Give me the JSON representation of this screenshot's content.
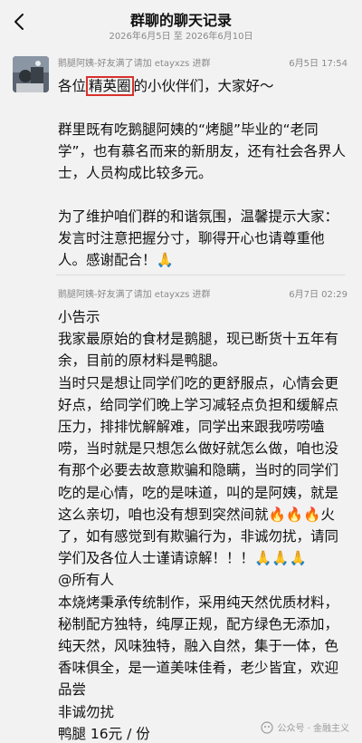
{
  "header": {
    "title": "群聊的聊天记录",
    "date_range": "2026年6月5日 至 2026年6月10日"
  },
  "messages": [
    {
      "sender": "鹅腿阿姨-好友满了请加 etayxzs 进群",
      "time": "6月5日 17:54",
      "greeting_before": "各位",
      "greeting_boxed": "精英圈",
      "greeting_after": "的小伙伴们，大家好～",
      "para2": "群里既有吃鹅腿阿姨的“烤腿”毕业的“老同学”，也有慕名而来的新朋友，还有社会各界人士，人员构成比较多元。",
      "para3": "为了维护咱们群的和谐氛围，温馨提示大家：发言时注意把握分寸，聊得开心也请尊重他人。感谢配合！🙏"
    },
    {
      "sender": "鹅腿阿姨-好友满了请加 etayxzs 进群",
      "time": "6月7日 02:29",
      "lines": [
        "小告示",
        "我家最原始的食材是鹅腿，现已断货十五年有余，目前的原材料是鸭腿。",
        "当时只是想让同学们吃的更舒服点，心情会更好点，给同学们晚上学习减轻点负担和缓解点压力，排排忧解解难，同学出来跟我唠唠嗑唠，当时就是只想怎么做好就怎么做，咱也没有那个必要去故意欺骗和隐瞒，当时的同学们吃的是心情，吃的是味道，叫的是阿姨，就是这么亲切，咱也没有想到突然间就🔥🔥🔥火了，如有感觉到有欺骗行为，非诚勿扰，请同学们及各位人士谨请谅解！！！🙏🙏🙏",
        "@所有人",
        "本烧烤秉承传统制作，采用纯天然优质材料，秘制配方独特，纯厚正规，配方绿色无添加，纯天然，风味独特，融入自然，集于一体，色香味俱全，是一道美味佳肴，老少皆宜，欢迎品尝",
        "非诚勿扰",
        "鸭腿 16元 / 份"
      ]
    }
  ],
  "watermark": "公众号 · 金融主义"
}
